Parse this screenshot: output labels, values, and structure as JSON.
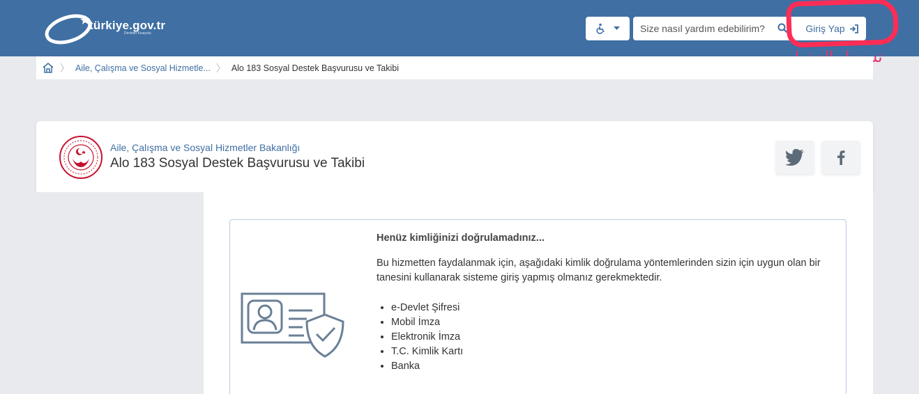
{
  "header": {
    "logo_text": "türkiye.gov.tr",
    "logo_tagline": "Devletin Kısayolu",
    "search_placeholder": "Size nasıl yardım edebilirim?",
    "login_label": "Giriş Yap",
    "accessibility_label": "Erişilebilirlik"
  },
  "annotation": {
    "arabic_text": "تسجيل الدخول",
    "marker_color": "#ff2d55"
  },
  "breadcrumb": {
    "items": [
      "Aile, Çalışma ve Sosyal Hizmetle...",
      "Alo 183 Sosyal Destek Başvurusu ve Takibi"
    ]
  },
  "service": {
    "ministry": "Aile, Çalışma ve Sosyal Hizmetler Bakanlığı",
    "title": "Alo 183 Sosyal Destek Başvurusu ve Takibi"
  },
  "notice": {
    "title": "Henüz kimliğinizi doğrulamadınız...",
    "description": "Bu hizmetten faydalanmak için, aşağıdaki kimlik doğrulama yöntemlerinden sizin için uygun olan bir tanesini kullanarak sisteme giriş yapmış olmanız gerekmektedir.",
    "methods": [
      "e-Devlet Şifresi",
      "Mobil İmza",
      "Elektronik İmza",
      "T.C. Kimlik Kartı",
      "Banka"
    ]
  },
  "colors": {
    "brand_blue": "#3f6fa3",
    "page_bg": "#e8eaee",
    "ministry_red": "#c8102e"
  }
}
